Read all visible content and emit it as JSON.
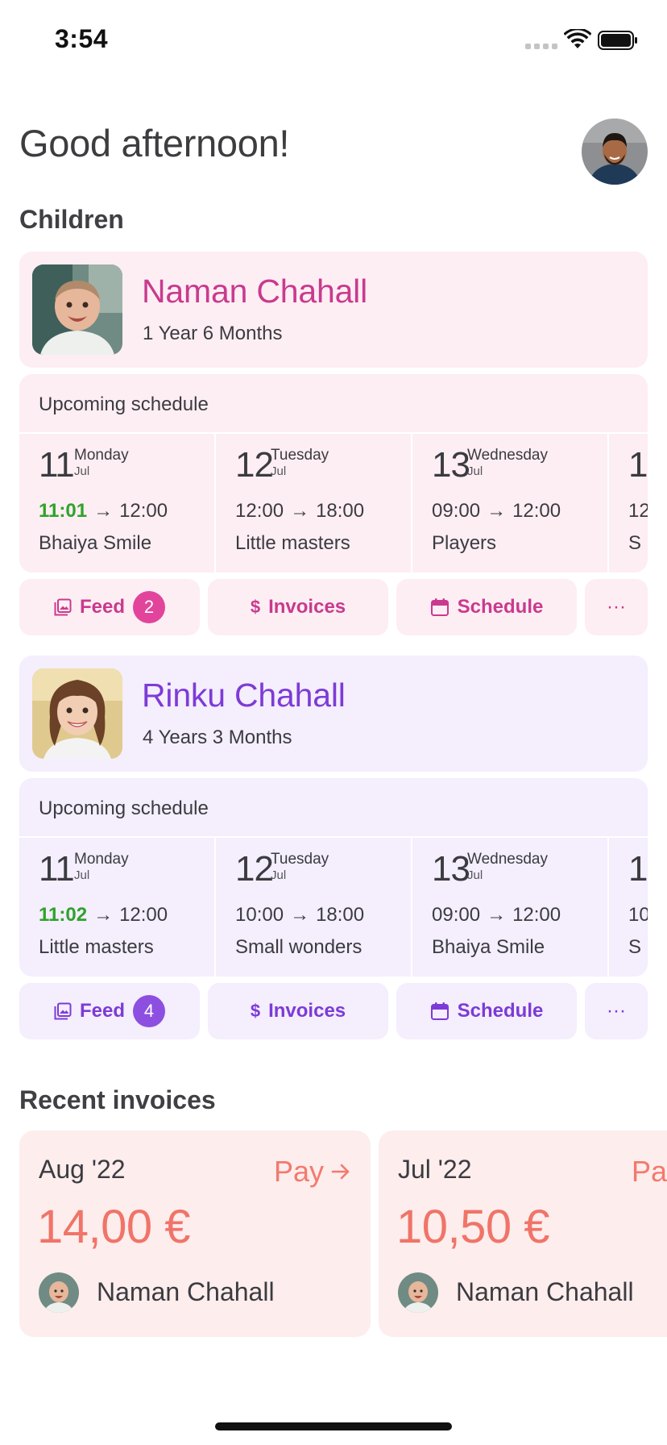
{
  "status_bar": {
    "time": "3:54"
  },
  "greeting": "Good afternoon!",
  "children_section": {
    "title": "Children"
  },
  "children": [
    {
      "name": "Naman Chahall",
      "age": "1 Year 6 Months",
      "accent": "#c93a8e",
      "schedule_title": "Upcoming schedule",
      "days": [
        {
          "num": "11",
          "weekday": "Monday",
          "month": "Jul",
          "start": "11:01",
          "end": "12:00",
          "place": "Bhaiya Smile",
          "live": true
        },
        {
          "num": "12",
          "weekday": "Tuesday",
          "month": "Jul",
          "start": "12:00",
          "end": "18:00",
          "place": "Little masters",
          "live": false
        },
        {
          "num": "13",
          "weekday": "Wednesday",
          "month": "Jul",
          "start": "09:00",
          "end": "12:00",
          "place": "Players",
          "live": false
        },
        {
          "num": "1",
          "weekday": "",
          "month": "",
          "start": "12",
          "end": "",
          "place": "S",
          "live": false
        }
      ],
      "actions": {
        "feed": "Feed",
        "feed_count": "2",
        "invoices": "Invoices",
        "schedule": "Schedule",
        "more": "···"
      }
    },
    {
      "name": "Rinku Chahall",
      "age": "4 Years 3 Months",
      "accent": "#7d3bd6",
      "schedule_title": "Upcoming schedule",
      "days": [
        {
          "num": "11",
          "weekday": "Monday",
          "month": "Jul",
          "start": "11:02",
          "end": "12:00",
          "place": "Little masters",
          "live": true
        },
        {
          "num": "12",
          "weekday": "Tuesday",
          "month": "Jul",
          "start": "10:00",
          "end": "18:00",
          "place": "Small wonders",
          "live": false
        },
        {
          "num": "13",
          "weekday": "Wednesday",
          "month": "Jul",
          "start": "09:00",
          "end": "12:00",
          "place": "Bhaiya Smile",
          "live": false
        },
        {
          "num": "1",
          "weekday": "",
          "month": "",
          "start": "10",
          "end": "",
          "place": "S",
          "live": false
        }
      ],
      "actions": {
        "feed": "Feed",
        "feed_count": "4",
        "invoices": "Invoices",
        "schedule": "Schedule",
        "more": "···"
      }
    }
  ],
  "invoices_section": {
    "title": "Recent invoices"
  },
  "invoices": [
    {
      "month": "Aug '22",
      "pay": "Pay",
      "amount": "14,00 €",
      "child": "Naman Chahall"
    },
    {
      "month": "Jul '22",
      "pay": "Pay",
      "amount": "10,50 €",
      "child": "Naman Chahall"
    }
  ],
  "colors": {
    "pink_bg": "#fdeef3",
    "purple_bg": "#f4eefd",
    "pink_accent": "#c93a8e",
    "pink_badge": "#e2449c",
    "purple_accent": "#7d3bd6",
    "purple_badge": "#8d4fe0",
    "live_green": "#2ea32a",
    "invoice_bg": "#fdeded",
    "invoice_accent": "#f07468"
  }
}
